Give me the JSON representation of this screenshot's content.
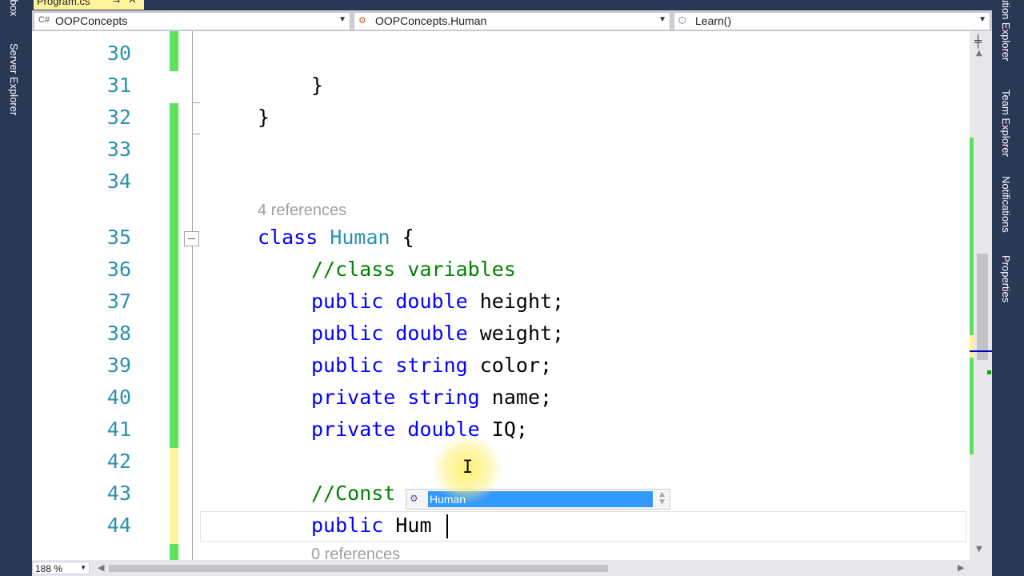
{
  "document_tab": {
    "title": "Program.cs",
    "pin": "→",
    "close": "✕"
  },
  "side_tabs_left": [
    "oolbox",
    "Server Explorer"
  ],
  "side_tabs_right": [
    "olution Explorer",
    "Team Explorer",
    "Notifications",
    "Properties"
  ],
  "navbar": {
    "project": "OOPConcepts",
    "type": "OOPConcepts.Human",
    "member": "Learn()"
  },
  "line_numbers": [
    "30",
    "31",
    "32",
    "33",
    "34",
    "35",
    "36",
    "37",
    "38",
    "39",
    "40",
    "41",
    "42",
    "43",
    "44"
  ],
  "code": {
    "line31_brace": "}",
    "line32_brace": "}",
    "lens_references": "4 references",
    "class_kw": "class",
    "class_name": "Human",
    "class_brace": "{",
    "comment_vars": "//class variables",
    "public_kw": "public",
    "private_kw": "private",
    "double_kw": "double",
    "string_kw": "string",
    "field_height": "height;",
    "field_weight": "weight;",
    "field_color": "color;",
    "field_name": "name;",
    "field_iq": "IQ;",
    "comment_constructor": "//Const",
    "typing": "Hum",
    "lens_zero": "0 references"
  },
  "intellisense": {
    "selected_item": "Human"
  },
  "zoom": "188 %",
  "colors": {
    "keyword": "#0000ff",
    "type": "#2b91af",
    "comment": "#008000",
    "line_number": "#2b91af",
    "saved_change": "#5ee25e",
    "unsaved_change": "#fff29d",
    "selection": "#3399ff"
  }
}
